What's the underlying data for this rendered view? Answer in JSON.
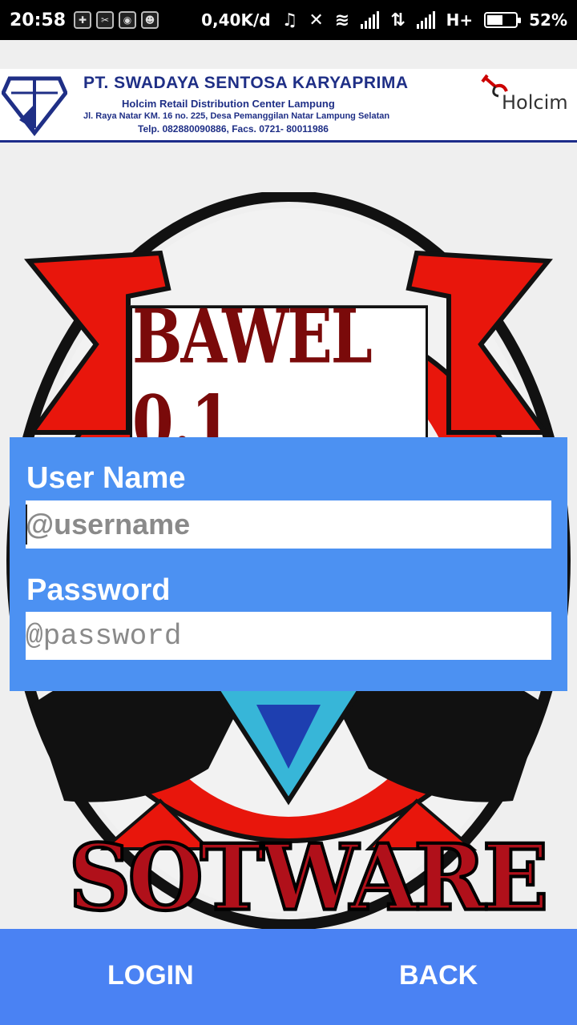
{
  "status_bar": {
    "time": "20:58",
    "speed": "0,40K/d",
    "network": "H+",
    "battery": "52%",
    "battery_level": 0.52
  },
  "company": {
    "name": "PT. SWADAYA SENTOSA KARYAPRIMA",
    "subtitle": "Holcim Retail Distribution Center Lampung",
    "address": "Jl. Raya Natar KM. 16 no. 225, Desa Pemanggilan Natar Lampung Selatan",
    "phone": "Telp. 082880090886, Facs. 0721- 80011986",
    "partner_logo": "Holcim"
  },
  "emblem": {
    "title": "BAWEL 0.1",
    "footer_word": "SOTWARE"
  },
  "form": {
    "username_label": "User Name",
    "username_placeholder": "@username",
    "password_label": "Password",
    "password_placeholder": "@password"
  },
  "actions": {
    "login_label": "LOGIN",
    "back_label": "BACK"
  },
  "colors": {
    "panel": "#4c91f2",
    "bottom_bar": "#4a82f3",
    "brand_blue": "#1f2f86",
    "emblem_red": "#e8160c"
  }
}
